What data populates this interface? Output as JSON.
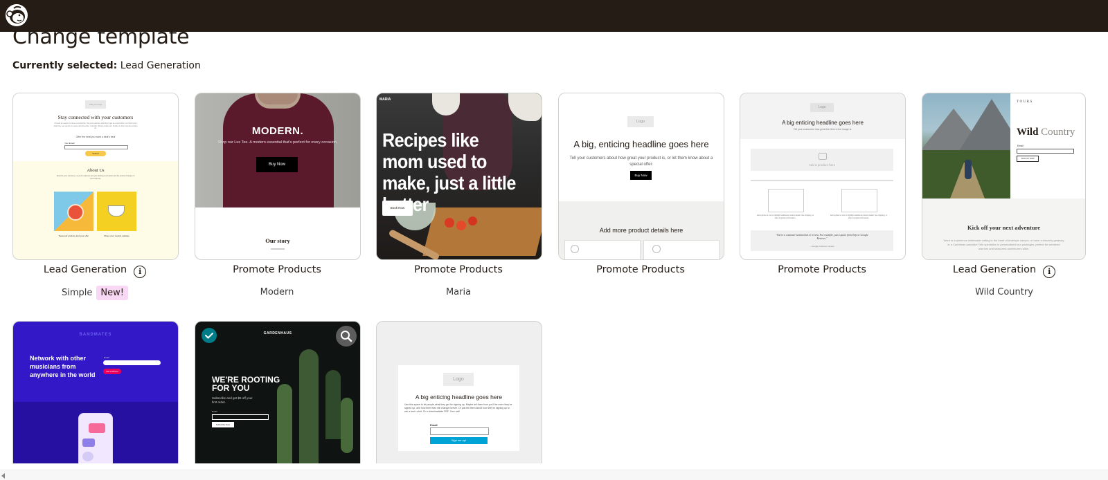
{
  "header": {
    "logo": "mailchimp-freddie-logo"
  },
  "page": {
    "title": "Change template",
    "selected_label": "Currently selected:",
    "selected_value": "Lead Generation"
  },
  "templates": [
    {
      "category": "Lead Generation",
      "name": "Simple",
      "badge": "New!",
      "has_info": true,
      "preview": {
        "logo_text": "Add your logo",
        "headline": "Stay connected with your customers",
        "body": "Provide an reason for these to subscribe: Tell your audience what they'll get as a subscriber. Let them know what they can expect to receive and how often. Consider offering a discount, freebie or other incentive to sign up.",
        "offer": "Offer the deal you want a deal's deal",
        "field": "Your Email",
        "button": "Submit",
        "link": "View our privacy policy",
        "about_title": "About Us",
        "about_body": "Describe your company. Let your customers and you identify your mission and the product changes in your business.",
        "card1_title": "Seasonal produce and your offer",
        "card2_title": "Share your newest updates"
      }
    },
    {
      "category": "Promote Products",
      "name": "Modern",
      "preview": {
        "brand": "MODERN.",
        "tagline": "Shop our Lux Tee. A modern essential that's perfect for every occasion.",
        "button": "Buy Now",
        "section": "Our story"
      }
    },
    {
      "category": "Promote Products",
      "name": "Maria",
      "preview": {
        "brand": "MARIA",
        "headline": "Recipes like mom used to make, just a little better",
        "button": "Book Now"
      }
    },
    {
      "category": "Promote Products",
      "preview": {
        "logo": "Logo",
        "headline": "A big, enticing headline goes here",
        "body": "Tell your customers about how great your product is, or let them know about a special offer.",
        "button": "Buy Now",
        "details": "Add more product details here"
      }
    },
    {
      "category": "Promote Products",
      "preview": {
        "logo": "Logo",
        "headline": "A big enticing headline goes here",
        "body": "Tell your customers how great the item in the image is.",
        "product_label": "Add a product here",
        "col1": "Add a photo or icon to highlight additional product details, free shipping, or other important information.",
        "col2": "Add a photo or icon to highlight additional product details, free shipping, or other important information.",
        "quote": "\"You're a customer testimonial or review. For example, put a quote from Yelp or Google Reviews.\"",
        "quote_author": "– Google customer review"
      }
    },
    {
      "category": "Lead Generation",
      "name": "Wild Country",
      "has_info": true,
      "preview": {
        "brand": "TOURS",
        "headline_a": "Wild",
        "headline_b": "Country",
        "field": "Email",
        "button": "SIGN UP NOW",
        "section": "Kick off your next adventure",
        "body": "Want to experience whitewater rafting in the heart of Antelope canyon, or have a leisurely getaway in a Caribbean paradise? We specialize in personalized tour packages, perfect for weekend warriors and seasoned adventurers alike."
      }
    },
    {
      "category": "",
      "name": "",
      "preview": {
        "brand": "BANDMATES",
        "headline": "Network with other musicians from anywhere in the world",
        "field": "Email",
        "button": "Get a Mentor"
      }
    },
    {
      "category": "",
      "name": "",
      "selected": true,
      "preview": {
        "brand": "GARDENHAUS",
        "headline": "WE'RE ROOTING FOR YOU",
        "body": "Subscribe and get $5 off your first order.",
        "field": "Email",
        "button": "Subscribe Now"
      }
    },
    {
      "category": "",
      "name": "",
      "preview": {
        "logo": "Logo",
        "headline": "A big enticing headline goes here",
        "body": "Use this space to let people what they get for signing up. Maybe tell them how you'll be more they've signed up, and how their lives will change forever. Or just tell them about how they're signing up to win a free t-shirt. Or a downloadable PDF. Your call!",
        "field": "Email",
        "button": "Sign me up!"
      }
    }
  ],
  "colors": {
    "topbar": "#241c15",
    "badge_bg": "#f8d8f4",
    "selected_check": "#007c89",
    "bandmates_purple": "#3318c8",
    "cta_pink": "#e8005c",
    "signup_blue": "#00a3d6"
  }
}
